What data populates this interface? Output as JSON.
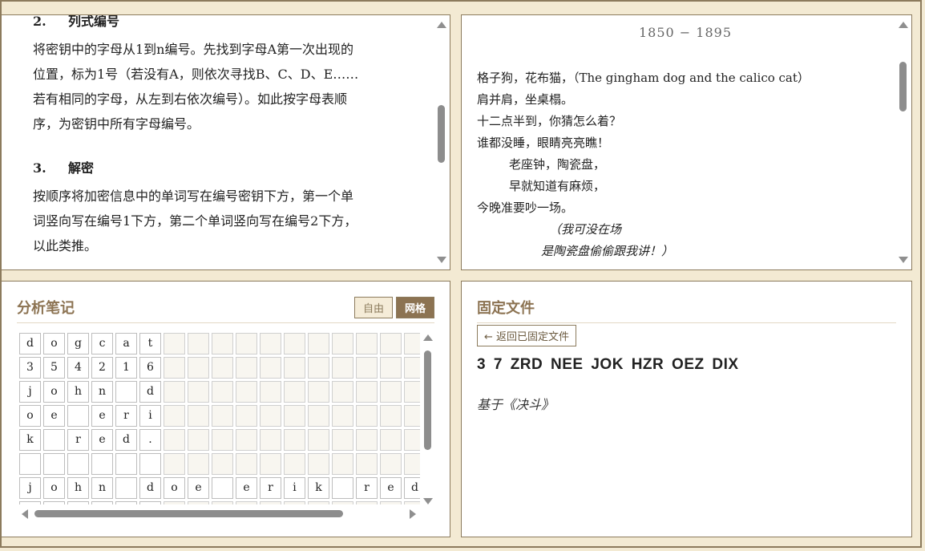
{
  "doc": {
    "section2_num": "2.",
    "section2_title": "列式编号",
    "para1": [
      "将密钥中的字母从1到n编号。先找到字母A第一次出现的",
      "位置，标为1号（若没有A，则依次寻找B、C、D、E……",
      "若有相同的字母，从左到右依次编号）。如此按字母表顺",
      "序，为密钥中所有字母编号。"
    ],
    "section3_num": "3.",
    "section3_title": "解密",
    "para2": [
      "按顺序将加密信息中的单词写在编号密钥下方，第一个单",
      "词竖向写在编号1下方，第二个单词竖向写在编号2下方，",
      "以此类推。"
    ]
  },
  "poem": {
    "dates": "1850 − 1895",
    "lines": [
      {
        "text": "格子狗，花布猫，（The gingham dog and the calico cat）",
        "style": "normal"
      },
      {
        "text": "肩并肩，坐桌榻。",
        "style": "normal"
      },
      {
        "text": "十二点半到，你猜怎么着？",
        "style": "normal"
      },
      {
        "text": "谁都没睡，眼睛亮亮瞧！",
        "style": "normal"
      },
      {
        "text": "老座钟，陶瓷盘，",
        "style": "ind1"
      },
      {
        "text": "早就知道有麻烦，",
        "style": "ind1"
      },
      {
        "text": "今晚准要吵一场。",
        "style": "normal"
      },
      {
        "text": "（我可没在场",
        "style": "ind2"
      },
      {
        "text": "是陶瓷盘偷偷跟我讲！）",
        "style": "ind3"
      }
    ]
  },
  "notes": {
    "title": "分析笔记",
    "tab_free": "自由",
    "tab_grid": "网格",
    "rows": [
      [
        "d",
        "o",
        "g",
        "c",
        "a",
        "t",
        "",
        "",
        "",
        "",
        "",
        "",
        "",
        "",
        "",
        "",
        "",
        ""
      ],
      [
        "3",
        "5",
        "4",
        "2",
        "1",
        "6",
        "",
        "",
        "",
        "",
        "",
        "",
        "",
        "",
        "",
        "",
        "",
        ""
      ],
      [
        "j",
        "o",
        "h",
        "n",
        "",
        "d",
        "",
        "",
        "",
        "",
        "",
        "",
        "",
        "",
        "",
        "",
        "",
        ""
      ],
      [
        "o",
        "e",
        "",
        "e",
        "r",
        "i",
        "",
        "",
        "",
        "",
        "",
        "",
        "",
        "",
        "",
        "",
        "",
        ""
      ],
      [
        "k",
        "",
        "r",
        "e",
        "d",
        ".",
        "",
        "",
        "",
        "",
        "",
        "",
        "",
        "",
        "",
        "",
        "",
        ""
      ],
      [
        "",
        "",
        "",
        "",
        "",
        "",
        "",
        "",
        "",
        "",
        "",
        "",
        "",
        "",
        "",
        "",
        "",
        ""
      ],
      [
        "j",
        "o",
        "h",
        "n",
        "",
        "d",
        "o",
        "e",
        "",
        "e",
        "r",
        "i",
        "k",
        "",
        "r",
        "e",
        "d",
        ""
      ],
      [
        "",
        "",
        "",
        "",
        "",
        "",
        "",
        "",
        "",
        "",
        "",
        "",
        "",
        "",
        "",
        "",
        "",
        ""
      ]
    ]
  },
  "pinned": {
    "title": "固定文件",
    "back_label": "← 返回已固定文件",
    "cipher": "3 7 ZRD NEE JOK HZR OEZ DIX",
    "based_on": "基于《决斗》"
  }
}
